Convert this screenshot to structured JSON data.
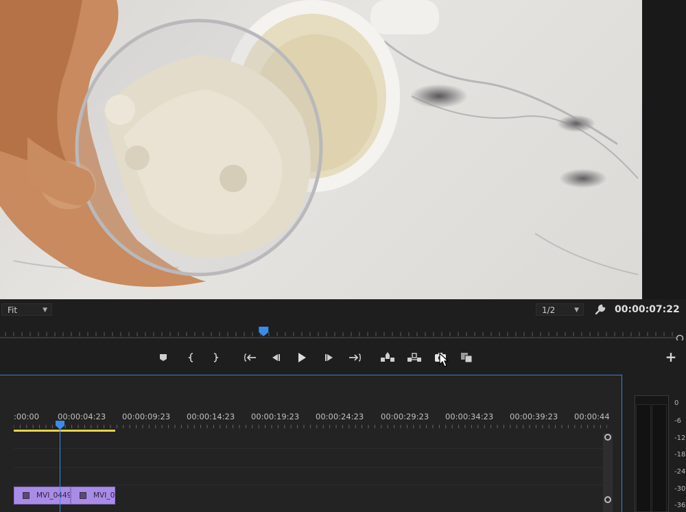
{
  "monitor": {
    "zoom_select": "Fit",
    "resolution_select": "1/2",
    "timecode": "00:00:07:22",
    "playhead_position_fraction": 0.386
  },
  "transport": {
    "buttons": [
      "add-marker",
      "mark-in",
      "mark-out",
      "go-to-in",
      "step-back",
      "play",
      "step-forward",
      "go-to-out",
      "lift",
      "extract",
      "export-frame",
      "comparison-view"
    ]
  },
  "timeline": {
    "ruler_labels": [
      ":00:00",
      "00:00:04:23",
      "00:00:09:23",
      "00:00:14:23",
      "00:00:19:23",
      "00:00:24:23",
      "00:00:29:23",
      "00:00:34:23",
      "00:00:39:23",
      "00:00:44"
    ],
    "clips": [
      {
        "name": "MVI_0449"
      },
      {
        "name": "MVI_0"
      }
    ]
  },
  "audio_meter": {
    "labels": [
      "0",
      "-6",
      "-12",
      "-18",
      "-24",
      "-30",
      "-36"
    ]
  },
  "colors": {
    "accent_blue": "#3a8ce8",
    "work_area_yellow": "#e8d545",
    "clip_purple": "#a98ce6"
  }
}
